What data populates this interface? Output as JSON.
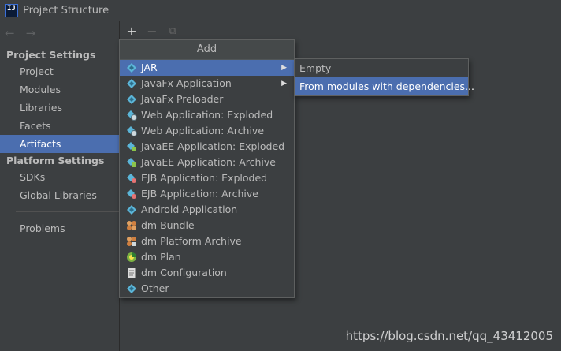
{
  "window": {
    "title": "Project Structure",
    "icon_text": "IJ"
  },
  "nav": {
    "back_icon": "←",
    "forward_icon": "→"
  },
  "sidebar": {
    "project_settings_header": "Project Settings",
    "project_items": [
      "Project",
      "Modules",
      "Libraries",
      "Facets",
      "Artifacts"
    ],
    "selected": "Artifacts",
    "platform_settings_header": "Platform Settings",
    "platform_items": [
      "SDKs",
      "Global Libraries"
    ],
    "problems": "Problems"
  },
  "toolbar": {
    "add": "+",
    "remove": "−",
    "copy": "⧉"
  },
  "add_menu": {
    "title": "Add",
    "items": [
      {
        "label": "JAR",
        "icon": "diamond-icon",
        "has_submenu": true,
        "highlighted": true
      },
      {
        "label": "JavaFx Application",
        "icon": "diamond-icon",
        "has_submenu": true
      },
      {
        "label": "JavaFx Preloader",
        "icon": "diamond-icon"
      },
      {
        "label": "Web Application: Exploded",
        "icon": "web-diamond-icon"
      },
      {
        "label": "Web Application: Archive",
        "icon": "web-diamond-icon"
      },
      {
        "label": "JavaEE Application: Exploded",
        "icon": "javaee-diamond-icon"
      },
      {
        "label": "JavaEE Application: Archive",
        "icon": "javaee-diamond-icon"
      },
      {
        "label": "EJB Application: Exploded",
        "icon": "ejb-diamond-icon"
      },
      {
        "label": "EJB Application: Archive",
        "icon": "ejb-diamond-icon"
      },
      {
        "label": "Android Application",
        "icon": "diamond-icon"
      },
      {
        "label": "dm Bundle",
        "icon": "dm-bundle-icon"
      },
      {
        "label": "dm Platform Archive",
        "icon": "dm-archive-icon"
      },
      {
        "label": "dm Plan",
        "icon": "dm-plan-icon"
      },
      {
        "label": "dm Configuration",
        "icon": "document-icon"
      },
      {
        "label": "Other",
        "icon": "diamond-icon"
      }
    ]
  },
  "jar_submenu": {
    "items": [
      {
        "label": "Empty"
      },
      {
        "label": "From modules with dependencies...",
        "highlighted": true
      }
    ]
  },
  "watermark": "https://blog.csdn.net/qq_43412005",
  "colors": {
    "background": "#3c3f41",
    "selection": "#4b6eaf",
    "text": "#bbbbbb",
    "diamond": "#5bb5d8"
  }
}
